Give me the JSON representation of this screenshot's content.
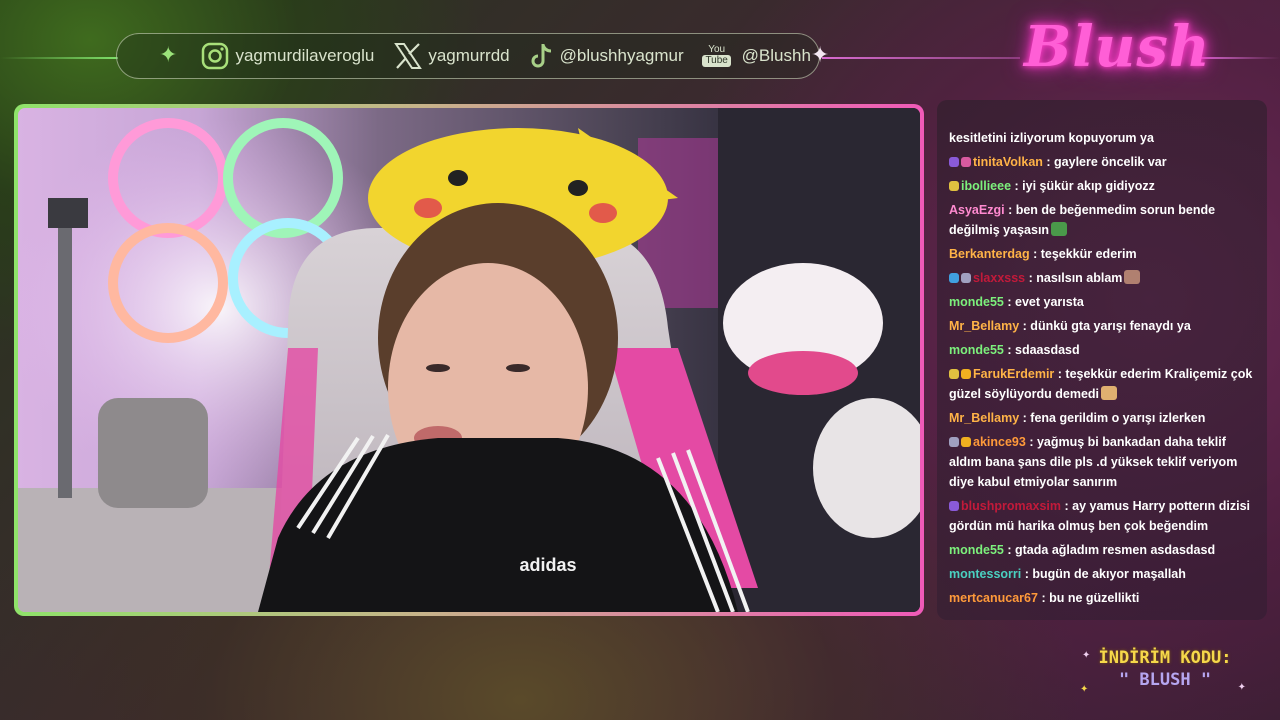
{
  "header": {
    "socials": [
      {
        "platform": "instagram",
        "handle": "yagmurdilaveroglu"
      },
      {
        "platform": "x",
        "handle": "yagmurrdd"
      },
      {
        "platform": "tiktok",
        "handle": "@blushhyagmur"
      },
      {
        "platform": "youtube",
        "handle": "@Blushh",
        "icon_top": "You",
        "icon_bottom": "Tube"
      }
    ],
    "sparkle": "✦"
  },
  "brand": {
    "logo_text": "Blush"
  },
  "chat": {
    "messages": [
      {
        "user": "",
        "text": "kesitletini izliyorum kopuyorum ya",
        "color": "#ffffff",
        "badges": []
      },
      {
        "user": "tinitaVolkan",
        "text": ": gaylere öncelik var",
        "color": "#ffb347",
        "badges": [
          "#8a5ad8",
          "#d85aa0"
        ]
      },
      {
        "user": "ibollieee",
        "text": ": iyi şükür akıp gidiyozz",
        "color": "#7cf07c",
        "badges": [
          "#e0c040"
        ]
      },
      {
        "user": "AsyaEzgi",
        "text": ": ben de beğenmedim sorun bende değilmiş yaşasın",
        "color": "#ff8ad0",
        "badges": [],
        "emote": "#4a9a4a"
      },
      {
        "user": "Berkanterdag",
        "text": ": teşekkür ederim",
        "color": "#ffb347",
        "badges": []
      },
      {
        "user": "slaxxsss",
        "text": ": nasılsın ablam",
        "color": "#c21a3a",
        "badges": [
          "#40a0e0",
          "#a0a0c0"
        ],
        "emote": "#b08070"
      },
      {
        "user": "monde55",
        "text": ": evet yarısta",
        "color": "#7cf07c",
        "badges": []
      },
      {
        "user": "Mr_Bellamy",
        "text": ": dünkü gta yarışı fenaydı ya",
        "color": "#ffb347",
        "badges": []
      },
      {
        "user": "monde55",
        "text": ": sdaasdasd",
        "color": "#7cf07c",
        "badges": []
      },
      {
        "user": "FarukErdemir",
        "text": ": teşekkür ederim Kraliçemiz çok güzel söylüyordu demedi",
        "color": "#ffb347",
        "badges": [
          "#e0c040",
          "#f0b020"
        ],
        "emote": "#e0b070"
      },
      {
        "user": "Mr_Bellamy",
        "text": ": fena gerildim o yarışı izlerken",
        "color": "#ffb347",
        "badges": []
      },
      {
        "user": "akince93",
        "text": ": yağmuş bi bankadan daha teklif aldım bana şans dile pls .d yüksek teklif veriyom diye kabul etmiyolar sanırım",
        "color": "#ff9a3a",
        "badges": [
          "#a0a0c0",
          "#f0b020"
        ]
      },
      {
        "user": "blushpromaxsim",
        "text": ": ay yamus Harry potterın dizisi gördün mü harika olmuş ben çok beğendim",
        "color": "#c21a3a",
        "badges": [
          "#8a5ad8"
        ]
      },
      {
        "user": "monde55",
        "text": ": gtada ağladım resmen asdasdasd",
        "color": "#7cf07c",
        "badges": []
      },
      {
        "user": "montessorri",
        "text": ": bugün de akıyor maşallah",
        "color": "#4ad0c0",
        "badges": []
      },
      {
        "user": "mertcanucar67",
        "text": ": bu ne güzellikti",
        "color": "#ff9a3a",
        "badges": []
      }
    ]
  },
  "promo": {
    "line1": "İNDİRİM KODU:",
    "line2": "\" BLUSH \""
  },
  "colors": {
    "green_accent": "#8fe36a",
    "pink_accent": "#f05ab8",
    "logo_pink": "#ff5fd6",
    "promo_yellow": "#f6d84a"
  }
}
